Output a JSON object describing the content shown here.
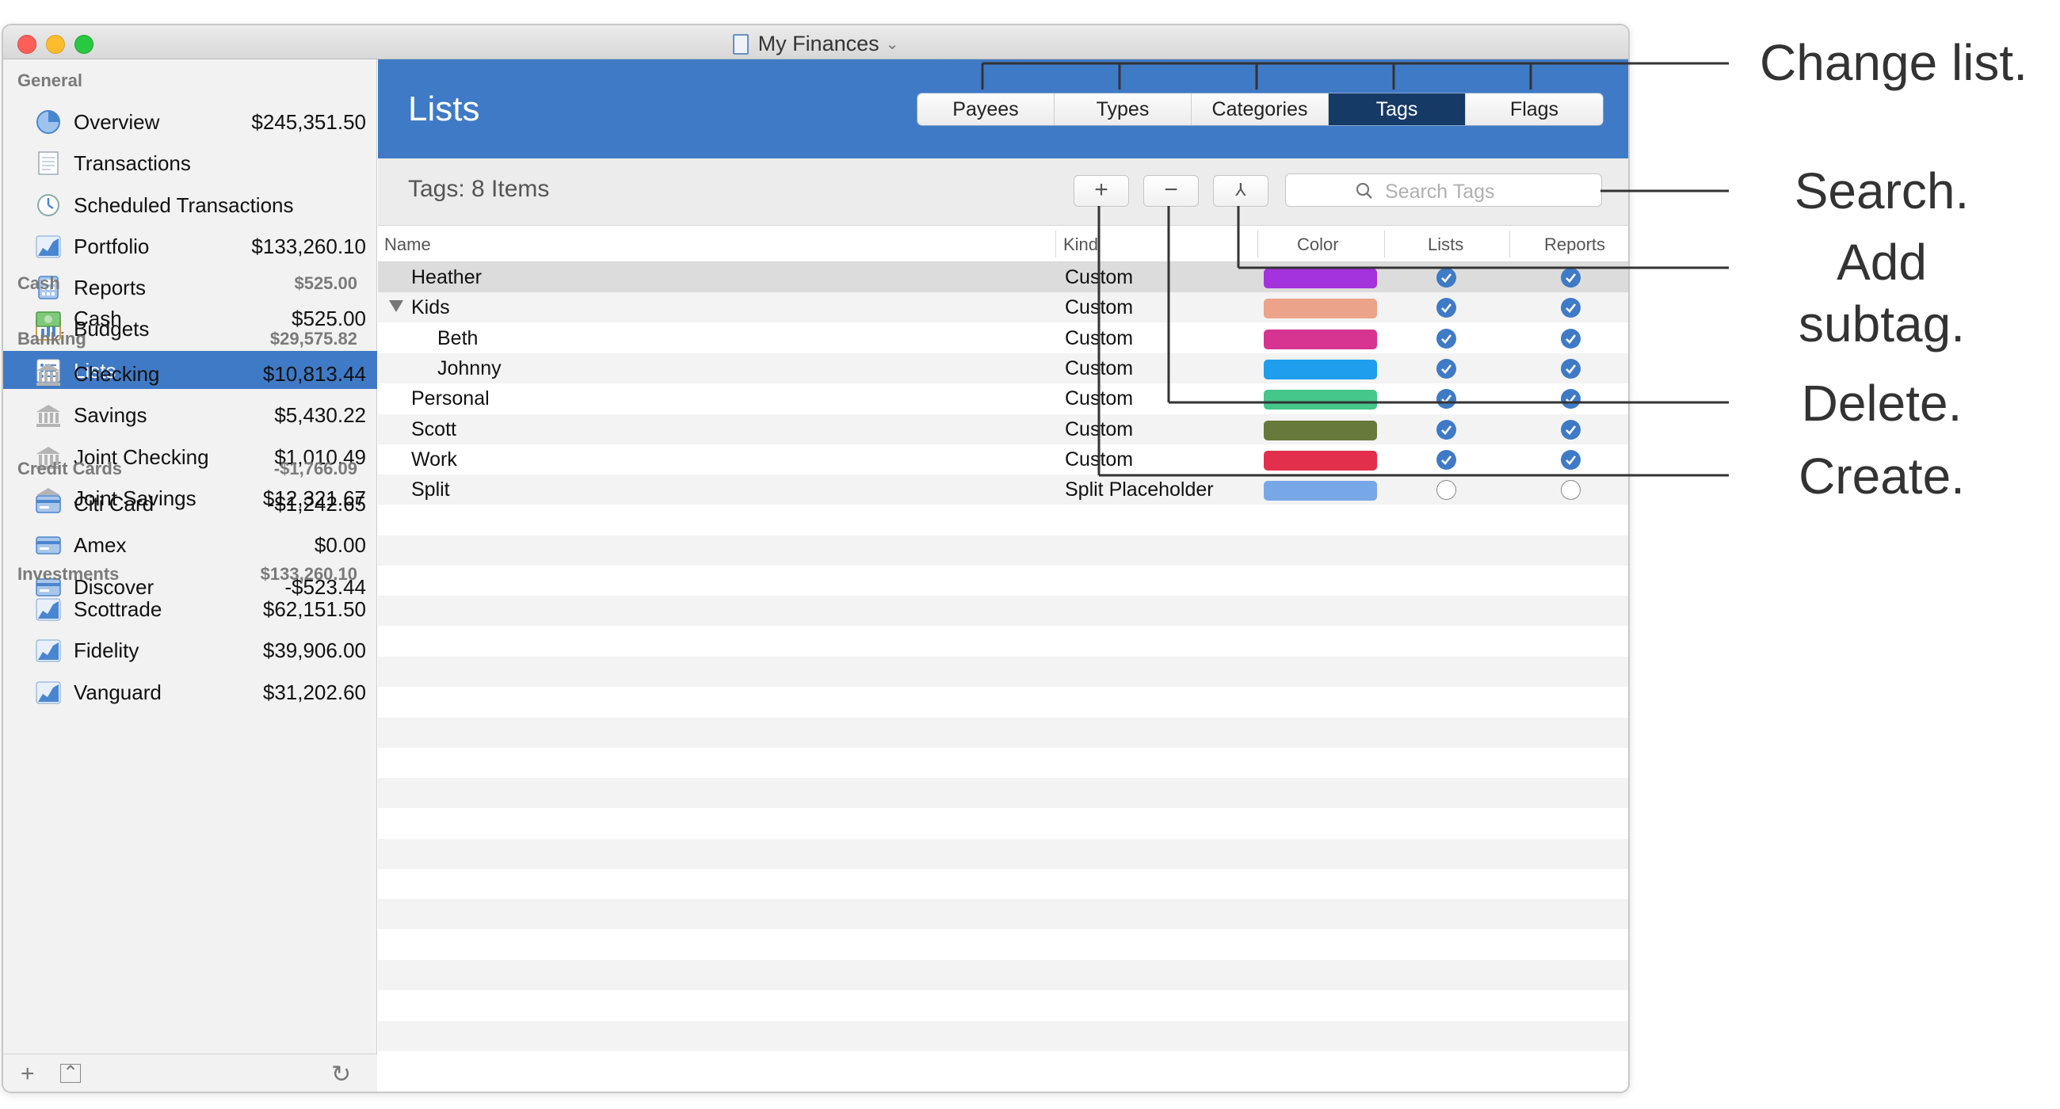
{
  "window": {
    "title": "My Finances"
  },
  "sidebar": {
    "sections": [
      {
        "key": "general",
        "title": "General",
        "total": "",
        "items": [
          {
            "label": "Overview",
            "value": "$245,351.50",
            "icon": "pie-chart-icon"
          },
          {
            "label": "Transactions",
            "value": "",
            "icon": "document-icon"
          },
          {
            "label": "Scheduled Transactions",
            "value": "",
            "icon": "clock-icon"
          },
          {
            "label": "Portfolio",
            "value": "$133,260.10",
            "icon": "line-chart-icon"
          },
          {
            "label": "Reports",
            "value": "",
            "icon": "calculator-icon"
          },
          {
            "label": "Budgets",
            "value": "",
            "icon": "bar-chart-icon"
          },
          {
            "label": "Lists",
            "value": "",
            "icon": "list-icon",
            "selected": true
          }
        ]
      },
      {
        "key": "cash",
        "title": "Cash",
        "total": "$525.00",
        "items": [
          {
            "label": "Cash",
            "value": "$525.00",
            "icon": "cash-icon"
          }
        ]
      },
      {
        "key": "banking",
        "title": "Banking",
        "total": "$29,575.82",
        "items": [
          {
            "label": "Checking",
            "value": "$10,813.44",
            "icon": "bank-icon"
          },
          {
            "label": "Savings",
            "value": "$5,430.22",
            "icon": "bank-icon"
          },
          {
            "label": "Joint Checking",
            "value": "$1,010.49",
            "icon": "bank-icon"
          },
          {
            "label": "Joint Savings",
            "value": "$12,321.67",
            "icon": "bank-icon"
          }
        ]
      },
      {
        "key": "credit",
        "title": "Credit Cards",
        "total": "-$1,766.09",
        "items": [
          {
            "label": "Citi Card",
            "value": "-$1,242.65",
            "icon": "credit-card-icon"
          },
          {
            "label": "Amex",
            "value": "$0.00",
            "icon": "credit-card-icon"
          },
          {
            "label": "Discover",
            "value": "-$523.44",
            "icon": "credit-card-icon"
          }
        ]
      },
      {
        "key": "investments",
        "title": "Investments",
        "total": "$133,260.10",
        "items": [
          {
            "label": "Scottrade",
            "value": "$62,151.50",
            "icon": "line-chart-icon"
          },
          {
            "label": "Fidelity",
            "value": "$39,906.00",
            "icon": "line-chart-icon"
          },
          {
            "label": "Vanguard",
            "value": "$31,202.60",
            "icon": "line-chart-icon"
          }
        ]
      }
    ],
    "bottom": {
      "add": "+",
      "collapse": "⌃",
      "refresh": "↻"
    }
  },
  "main": {
    "title": "Lists",
    "tabs": [
      {
        "label": "Payees",
        "active": false
      },
      {
        "label": "Types",
        "active": false
      },
      {
        "label": "Categories",
        "active": false
      },
      {
        "label": "Tags",
        "active": true
      },
      {
        "label": "Flags",
        "active": false
      }
    ],
    "count_label": "Tags: 8 Items",
    "buttons": {
      "create": "+",
      "delete": "−",
      "subtag": "⅄"
    },
    "search": {
      "placeholder": "Search Tags"
    },
    "columns": {
      "name": "Name",
      "kind": "Kind",
      "color": "Color",
      "lists": "Lists",
      "reports": "Reports"
    },
    "rows": [
      {
        "name": "Heather",
        "kind": "Custom",
        "color": "#a433dd",
        "lists": true,
        "reports": true,
        "level": 0,
        "selected": true
      },
      {
        "name": "Kids",
        "kind": "Custom",
        "color": "#eba489",
        "lists": true,
        "reports": true,
        "level": 0,
        "expanded": true
      },
      {
        "name": "Beth",
        "kind": "Custom",
        "color": "#d63490",
        "lists": true,
        "reports": true,
        "level": 1
      },
      {
        "name": "Johnny",
        "kind": "Custom",
        "color": "#1e9eed",
        "lists": true,
        "reports": true,
        "level": 1
      },
      {
        "name": "Personal",
        "kind": "Custom",
        "color": "#45c68a",
        "lists": true,
        "reports": true,
        "level": 0
      },
      {
        "name": "Scott",
        "kind": "Custom",
        "color": "#667a3b",
        "lists": true,
        "reports": true,
        "level": 0
      },
      {
        "name": "Work",
        "kind": "Custom",
        "color": "#e2304c",
        "lists": true,
        "reports": true,
        "level": 0
      },
      {
        "name": "Split",
        "kind": "Split Placeholder",
        "color": "#78a7e8",
        "lists": false,
        "reports": false,
        "level": 0
      }
    ]
  },
  "callouts": {
    "change_list": "Change list.",
    "search": "Search.",
    "add_subtag": "Add subtag.",
    "delete": "Delete.",
    "create": "Create."
  },
  "colors": {
    "accent": "#3f7ac6",
    "active_tab": "#163a66"
  }
}
